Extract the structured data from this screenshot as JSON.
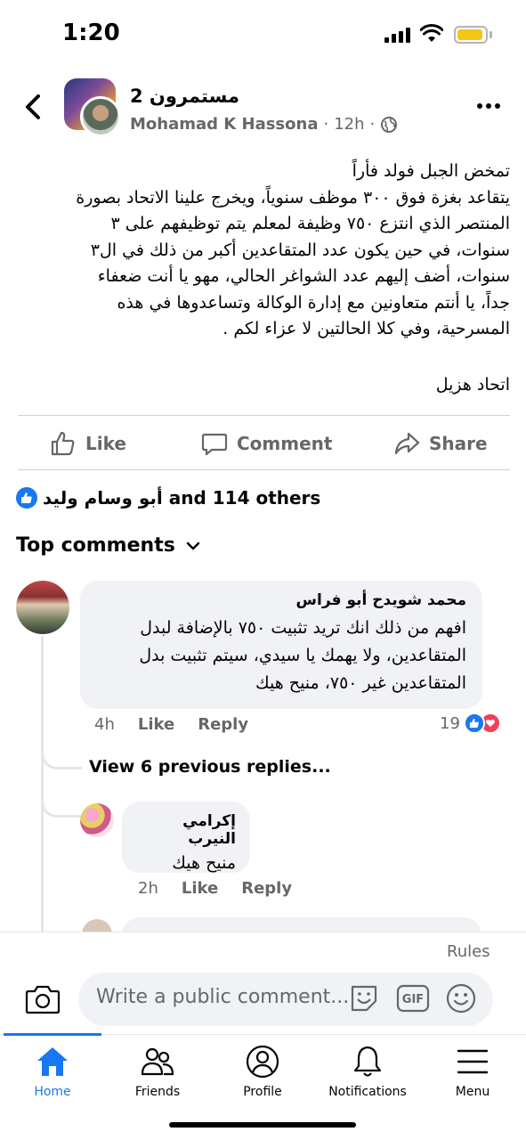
{
  "status_bar": {
    "time": "1:20"
  },
  "post": {
    "group_name": "مستمرون 2",
    "author": "Mohamad K Hassona",
    "time": "12h",
    "separator": "·",
    "body_lines": [
      "تمخض الجبل فولد فأراً",
      "يتقاعد بغزة فوق ٣٠٠ موظف سنوياً، ويخرج علينا الاتحاد بصورة",
      "المنتصر الذي انتزع ٧٥٠ وظيفة لمعلم يتم توظيفهم على ٣",
      "سنوات، في حين يكون عدد المتقاعدين أكبر من ذلك في ال٣",
      "سنوات، أضف إليهم عدد الشواغر الحالي، مهو يا أنت ضعفاء",
      "جداً، يا أنتم متعاونين مع إدارة الوكالة وتساعدوها في هذه",
      "المسرحية، وفي كلا الحالتين لا عزاء لكم ."
    ],
    "signature": "اتحاد هزيل"
  },
  "actions": {
    "like": "Like",
    "comment": "Comment",
    "share": "Share"
  },
  "reactions": {
    "summary": "أبو وسام وليد and 114 others"
  },
  "top_comments_label": "Top comments",
  "comments": [
    {
      "name": "محمد شويدح أبو فراس",
      "lines": [
        "افهم من ذلك انك تريد تثبيت ٧٥٠ بالإضافة لبدل",
        "المتقاعدين، ولا يهمك يا سيدي، سيتم تثبيت بدل",
        "المتقاعدين غير ٧٥٠، منيح هيك"
      ],
      "time": "4h",
      "like": "Like",
      "reply": "Reply",
      "reaction_count": "19"
    }
  ],
  "view_previous": "View 6 previous replies...",
  "replies": [
    {
      "name": "إكرامي النيرب",
      "text": "منيح هيك",
      "time": "2h",
      "like": "Like",
      "reply": "Reply"
    }
  ],
  "composer": {
    "rules": "Rules",
    "placeholder": "Write a public comment..."
  },
  "tabs": [
    {
      "label": "Home",
      "icon": "home-icon"
    },
    {
      "label": "Friends",
      "icon": "friends-icon"
    },
    {
      "label": "Profile",
      "icon": "profile-icon"
    },
    {
      "label": "Notifications",
      "icon": "bell-icon"
    },
    {
      "label": "Menu",
      "icon": "menu-icon"
    }
  ],
  "colors": {
    "accent": "#1877f2",
    "secondary_text": "#65676b",
    "bubble": "#f0f2f5",
    "love": "#f33e58",
    "battery": "#f5c518"
  }
}
